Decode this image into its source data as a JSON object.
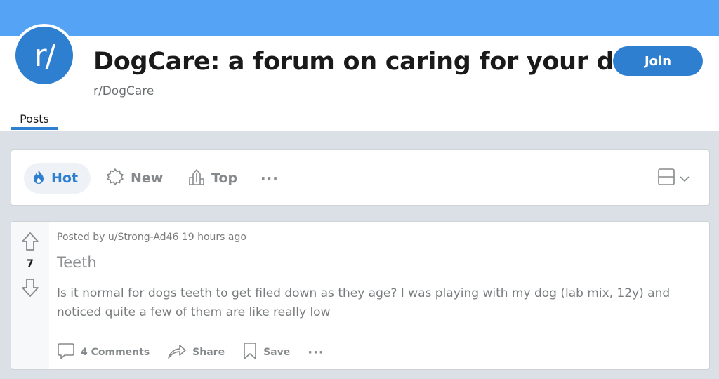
{
  "community": {
    "avatar_text": "r/",
    "title": "DogCare: a forum on caring for your dog.",
    "name": "r/DogCare",
    "join_label": "Join"
  },
  "tabs": {
    "posts_label": "Posts"
  },
  "sort": {
    "hot_label": "Hot",
    "new_label": "New",
    "top_label": "Top",
    "more_label": "···"
  },
  "post": {
    "votes": "7",
    "meta": "Posted by u/Strong-Ad46 19 hours ago",
    "title": "Teeth",
    "body": "Is it normal for dogs teeth to get filed down as they age? I was playing with my dog (lab mix, 12y) and noticed quite a few of them are like really low",
    "comments_label": "4 Comments",
    "share_label": "Share",
    "save_label": "Save",
    "more_label": "···"
  },
  "colors": {
    "banner": "#54a3f4",
    "accent": "#2f7fd1",
    "page_bg": "#dae0e6"
  }
}
